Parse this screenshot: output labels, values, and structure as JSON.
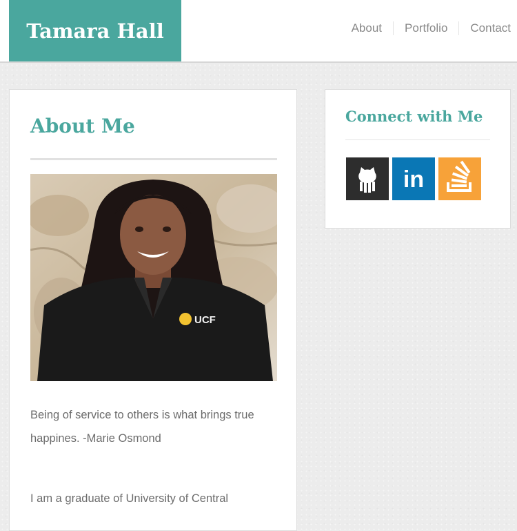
{
  "site": {
    "brand": "Tamara Hall"
  },
  "nav": [
    {
      "label": "About"
    },
    {
      "label": "Portfolio"
    },
    {
      "label": "Contact"
    }
  ],
  "about": {
    "title": "About Me",
    "photo_alt": "Portrait photo",
    "shirt_logo_text": "UCF",
    "quote": "Being of service to others is what brings true happines. -Marie Osmond",
    "bio": "I am a graduate of University of Central"
  },
  "connect": {
    "title": "Connect with Me",
    "links": [
      {
        "icon": "github-icon",
        "color": "#2d2d2d"
      },
      {
        "icon": "linkedin-icon",
        "color": "#0a77b5",
        "text": "in"
      },
      {
        "icon": "stackoverflow-icon",
        "color": "#f7a239"
      }
    ]
  },
  "colors": {
    "accent": "#4aa79e",
    "text": "#6b6b6b",
    "nav_text": "#8a8a8a"
  }
}
